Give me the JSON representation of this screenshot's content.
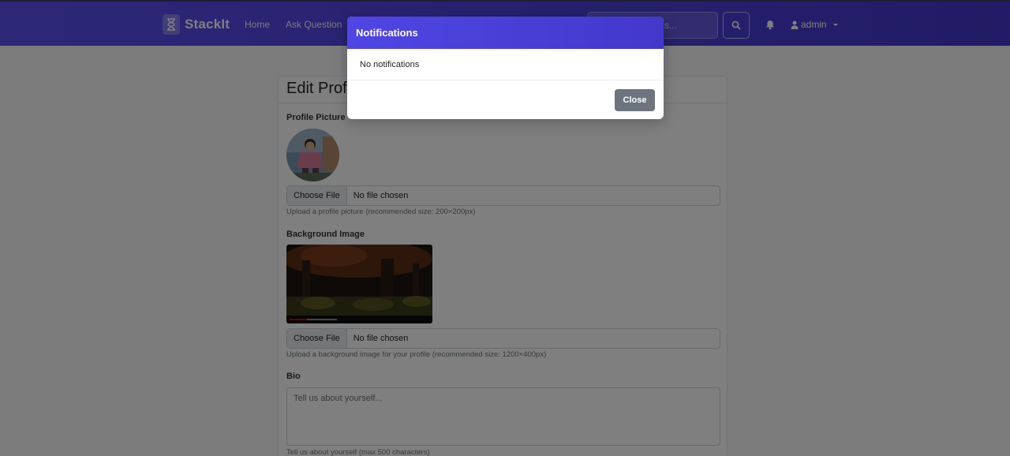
{
  "navbar": {
    "brand": "StackIt",
    "links": [
      "Home",
      "Ask Question"
    ],
    "search_placeholder": "Search questions...",
    "user": "admin"
  },
  "profile_form": {
    "title": "Edit Profile",
    "profile_picture_label": "Profile Picture",
    "choose_file": "Choose File",
    "no_file": "No file chosen",
    "profile_help": "Upload a profile picture (recommended size: 200×200px)",
    "background_label": "Background Image",
    "background_help": "Upload a background image for your profile (recommended size: 1200×400px)",
    "bio_label": "Bio",
    "bio_placeholder": "Tell us about yourself...",
    "bio_help": "Tell us about yourself (max 500 characters)"
  },
  "modal": {
    "title": "Notifications",
    "message": "No notifications",
    "close_label": "Close"
  },
  "colors": {
    "navbar": "#4e44e0",
    "modal_header": "#4f46e5",
    "close_button": "#6c757d"
  }
}
